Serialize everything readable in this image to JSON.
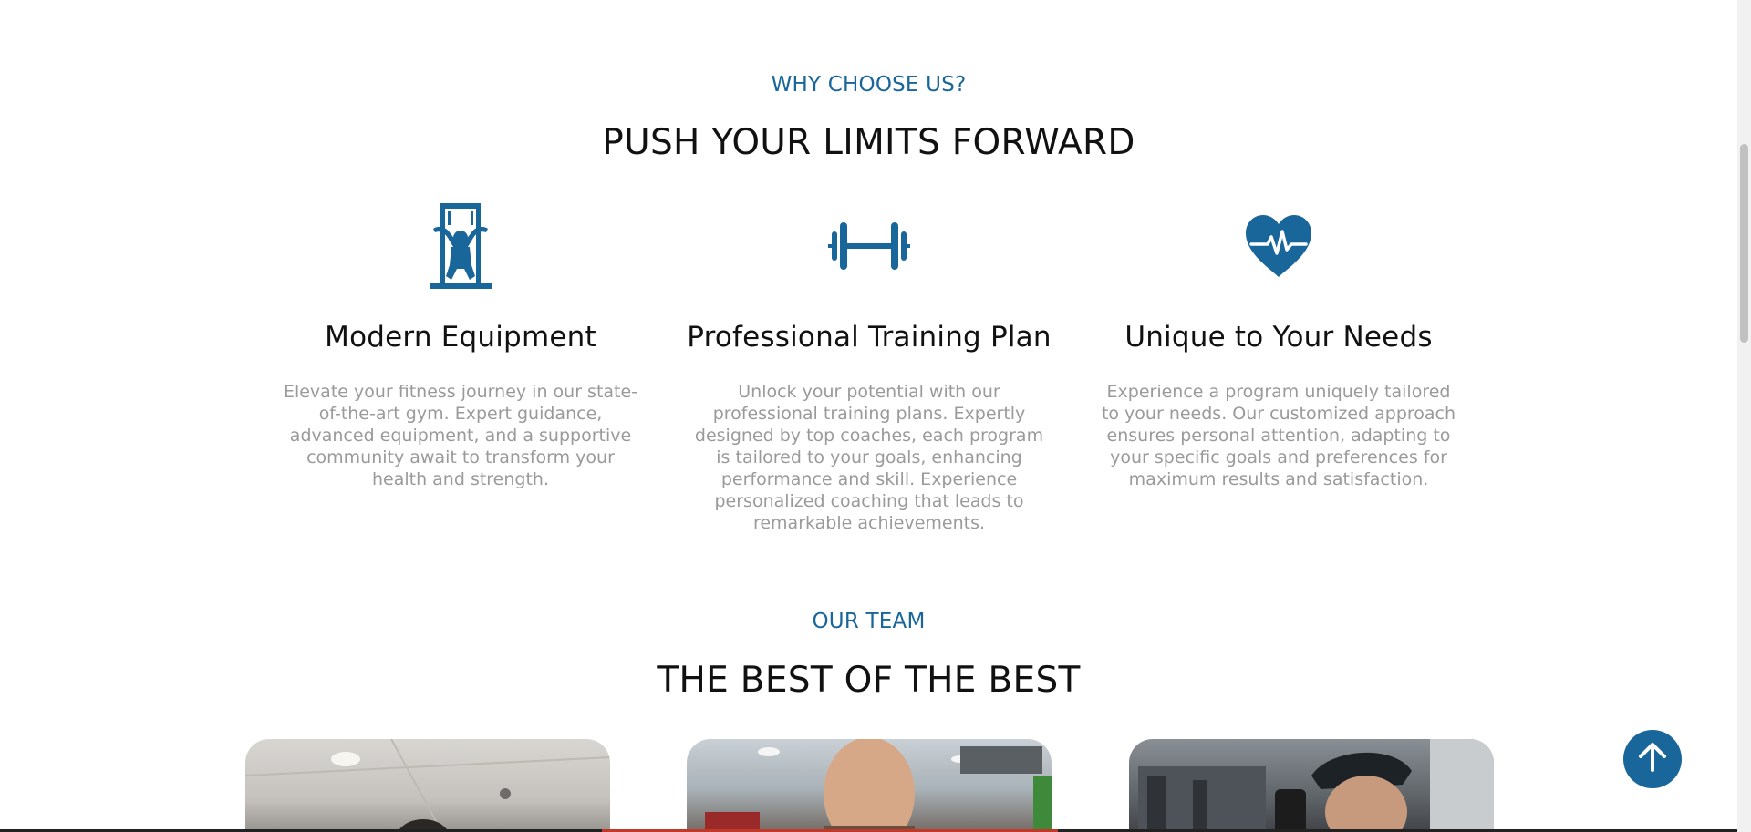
{
  "why": {
    "eyebrow": "WHY CHOOSE US?",
    "title": "PUSH YOUR LIMITS FORWARD"
  },
  "features": [
    {
      "icon": "gym-machine-icon",
      "title": "Modern Equipment",
      "text": "Elevate your fitness journey in our state-of-the-art gym. Expert guidance, advanced equipment, and a supportive community await to transform your health and strength."
    },
    {
      "icon": "dumbbell-icon",
      "title": "Professional Training Plan",
      "text": "Unlock your potential with our professional training plans. Expertly designed by top coaches, each program is tailored to your goals, enhancing performance and skill. Experience personalized coaching that leads to remarkable achievements."
    },
    {
      "icon": "heart-pulse-icon",
      "title": "Unique to Your Needs",
      "text": "Experience a program uniquely tailored to your needs. Our customized approach ensures personal attention, adapting to your specific goals and preferences for maximum results and satisfaction."
    }
  ],
  "team": {
    "eyebrow": "OUR TEAM",
    "title": "THE BEST OF THE BEST"
  },
  "colors": {
    "accent": "#19669b",
    "body_text": "#9a9a9a",
    "heading": "#111111"
  },
  "scroll_top_icon": "arrow-up-icon"
}
